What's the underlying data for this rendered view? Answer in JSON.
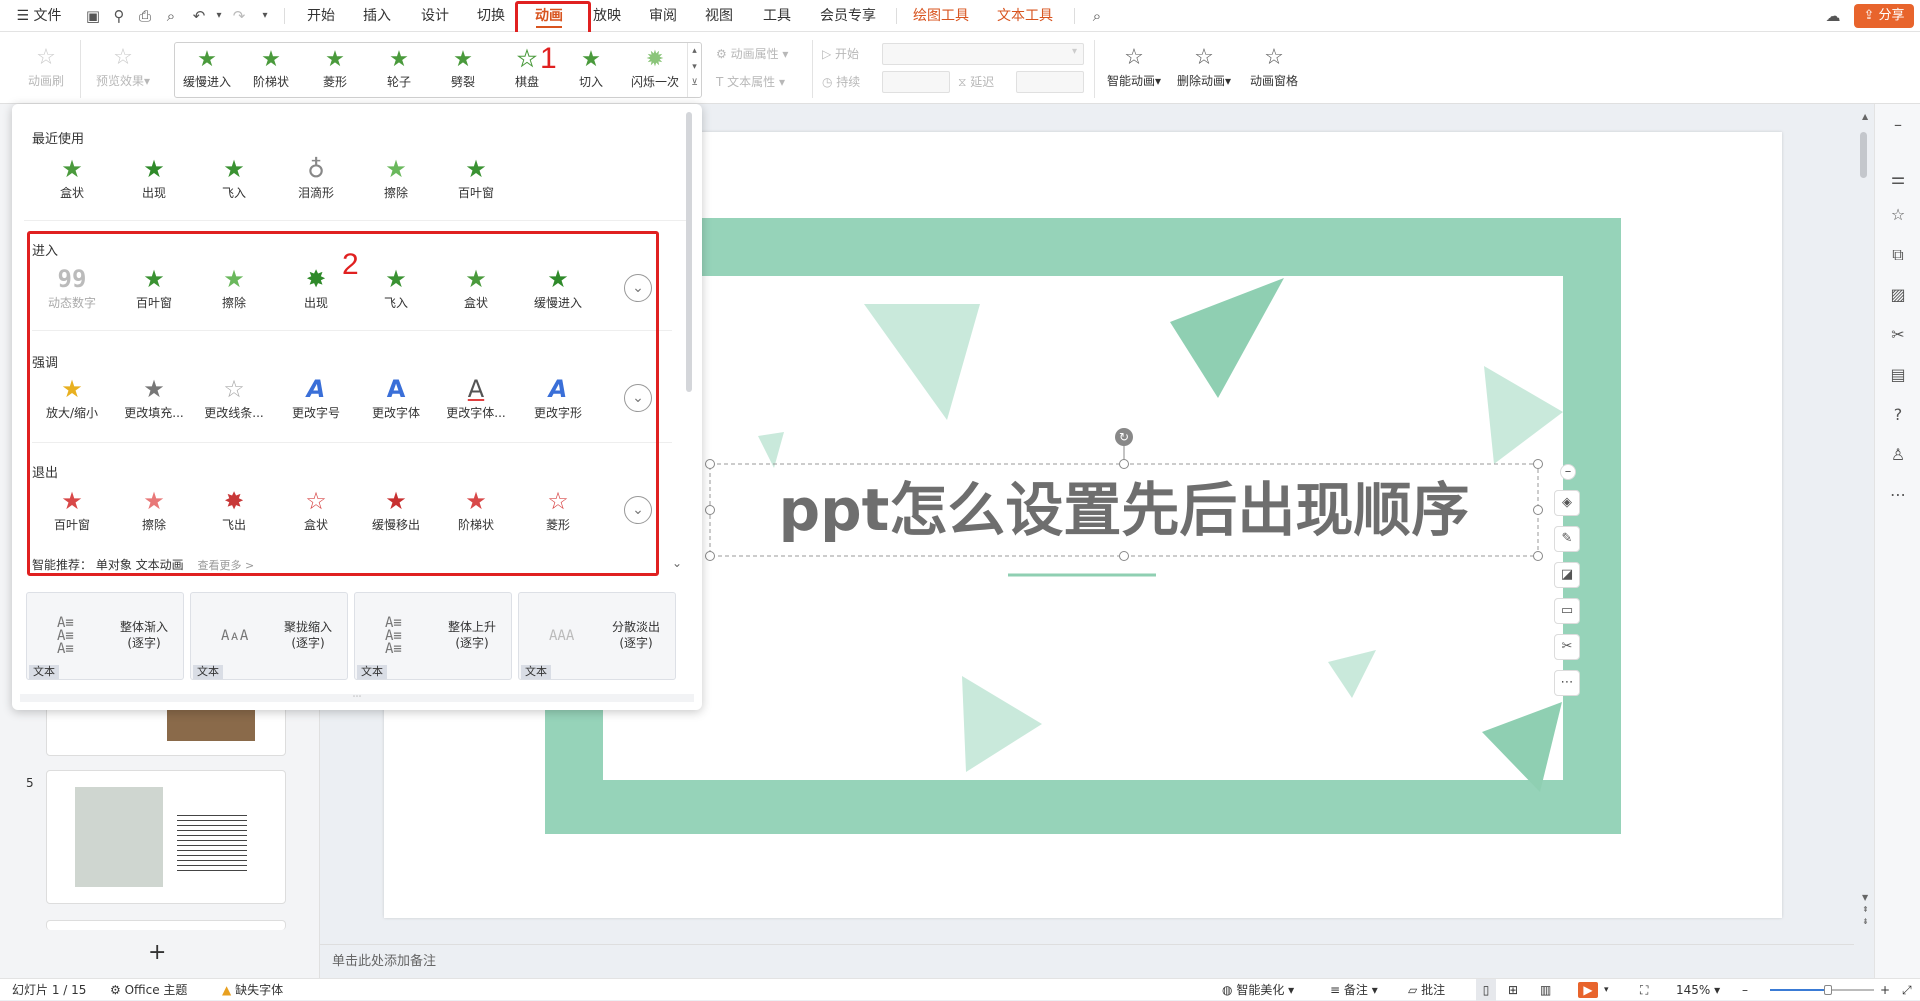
{
  "menubar": {
    "file": "文件",
    "tabs": [
      "开始",
      "插入",
      "设计",
      "切换",
      "动画",
      "放映",
      "审阅",
      "视图",
      "工具",
      "会员专享"
    ],
    "context_tabs": [
      "绘图工具",
      "文本工具"
    ],
    "active_tab": "动画",
    "share": "分享"
  },
  "annotations": {
    "one": "1",
    "two": "2"
  },
  "ribbon": {
    "animation_brush": "动画刷",
    "preview": "预览效果",
    "gallery": [
      "缓慢进入",
      "阶梯状",
      "菱形",
      "轮子",
      "劈裂",
      "棋盘",
      "切入",
      "闪烁一次"
    ],
    "anim_props": "动画属性",
    "text_props": "文本属性",
    "start": "开始",
    "duration": "持续",
    "delay": "延迟",
    "smart_anim": "智能动画",
    "delete_anim": "删除动画",
    "anim_pane": "动画窗格"
  },
  "dropdown": {
    "recent_title": "最近使用",
    "recent": [
      "盒状",
      "出现",
      "飞入",
      "泪滴形",
      "擦除",
      "百叶窗"
    ],
    "enter_title": "进入",
    "enter": [
      "动态数字",
      "百叶窗",
      "擦除",
      "出现",
      "飞入",
      "盒状",
      "缓慢进入"
    ],
    "emphasis_title": "强调",
    "emphasis": [
      "放大/缩小",
      "更改填充...",
      "更改线条...",
      "更改字号",
      "更改字体",
      "更改字体...",
      "更改字形"
    ],
    "exit_title": "退出",
    "exit": [
      "百叶窗",
      "擦除",
      "飞出",
      "盒状",
      "缓慢移出",
      "阶梯状",
      "菱形"
    ],
    "smart_rec": "智能推荐：",
    "single_obj": "单对象 文本动画",
    "see_more": "查看更多 >",
    "cards": [
      {
        "name": "整体渐入\n(逐字)",
        "tag": "文本"
      },
      {
        "name": "聚拢缩入\n(逐字)",
        "tag": "文本"
      },
      {
        "name": "整体上升\n(逐字)",
        "tag": "文本"
      },
      {
        "name": "分散淡出\n(逐字)",
        "tag": "文本"
      }
    ]
  },
  "slides": {
    "slide5_number": "5"
  },
  "slide": {
    "title": "ppt怎么设置先后出现顺序"
  },
  "notes_placeholder": "单击此处添加备注",
  "statusbar": {
    "slide_count": "幻灯片 1 / 15",
    "theme": "Office 主题",
    "missing_font": "缺失字体",
    "beautify": "智能美化",
    "notes": "备注",
    "comments": "批注",
    "zoom": "145%"
  },
  "colors": {
    "accent": "#d8541f",
    "frame_green": "#96d3b9",
    "triangle_light": "#c9e9db",
    "triangle_mid": "#8fcfb2",
    "title_gray": "#6e6e6e",
    "annotation_red": "#e02020"
  }
}
